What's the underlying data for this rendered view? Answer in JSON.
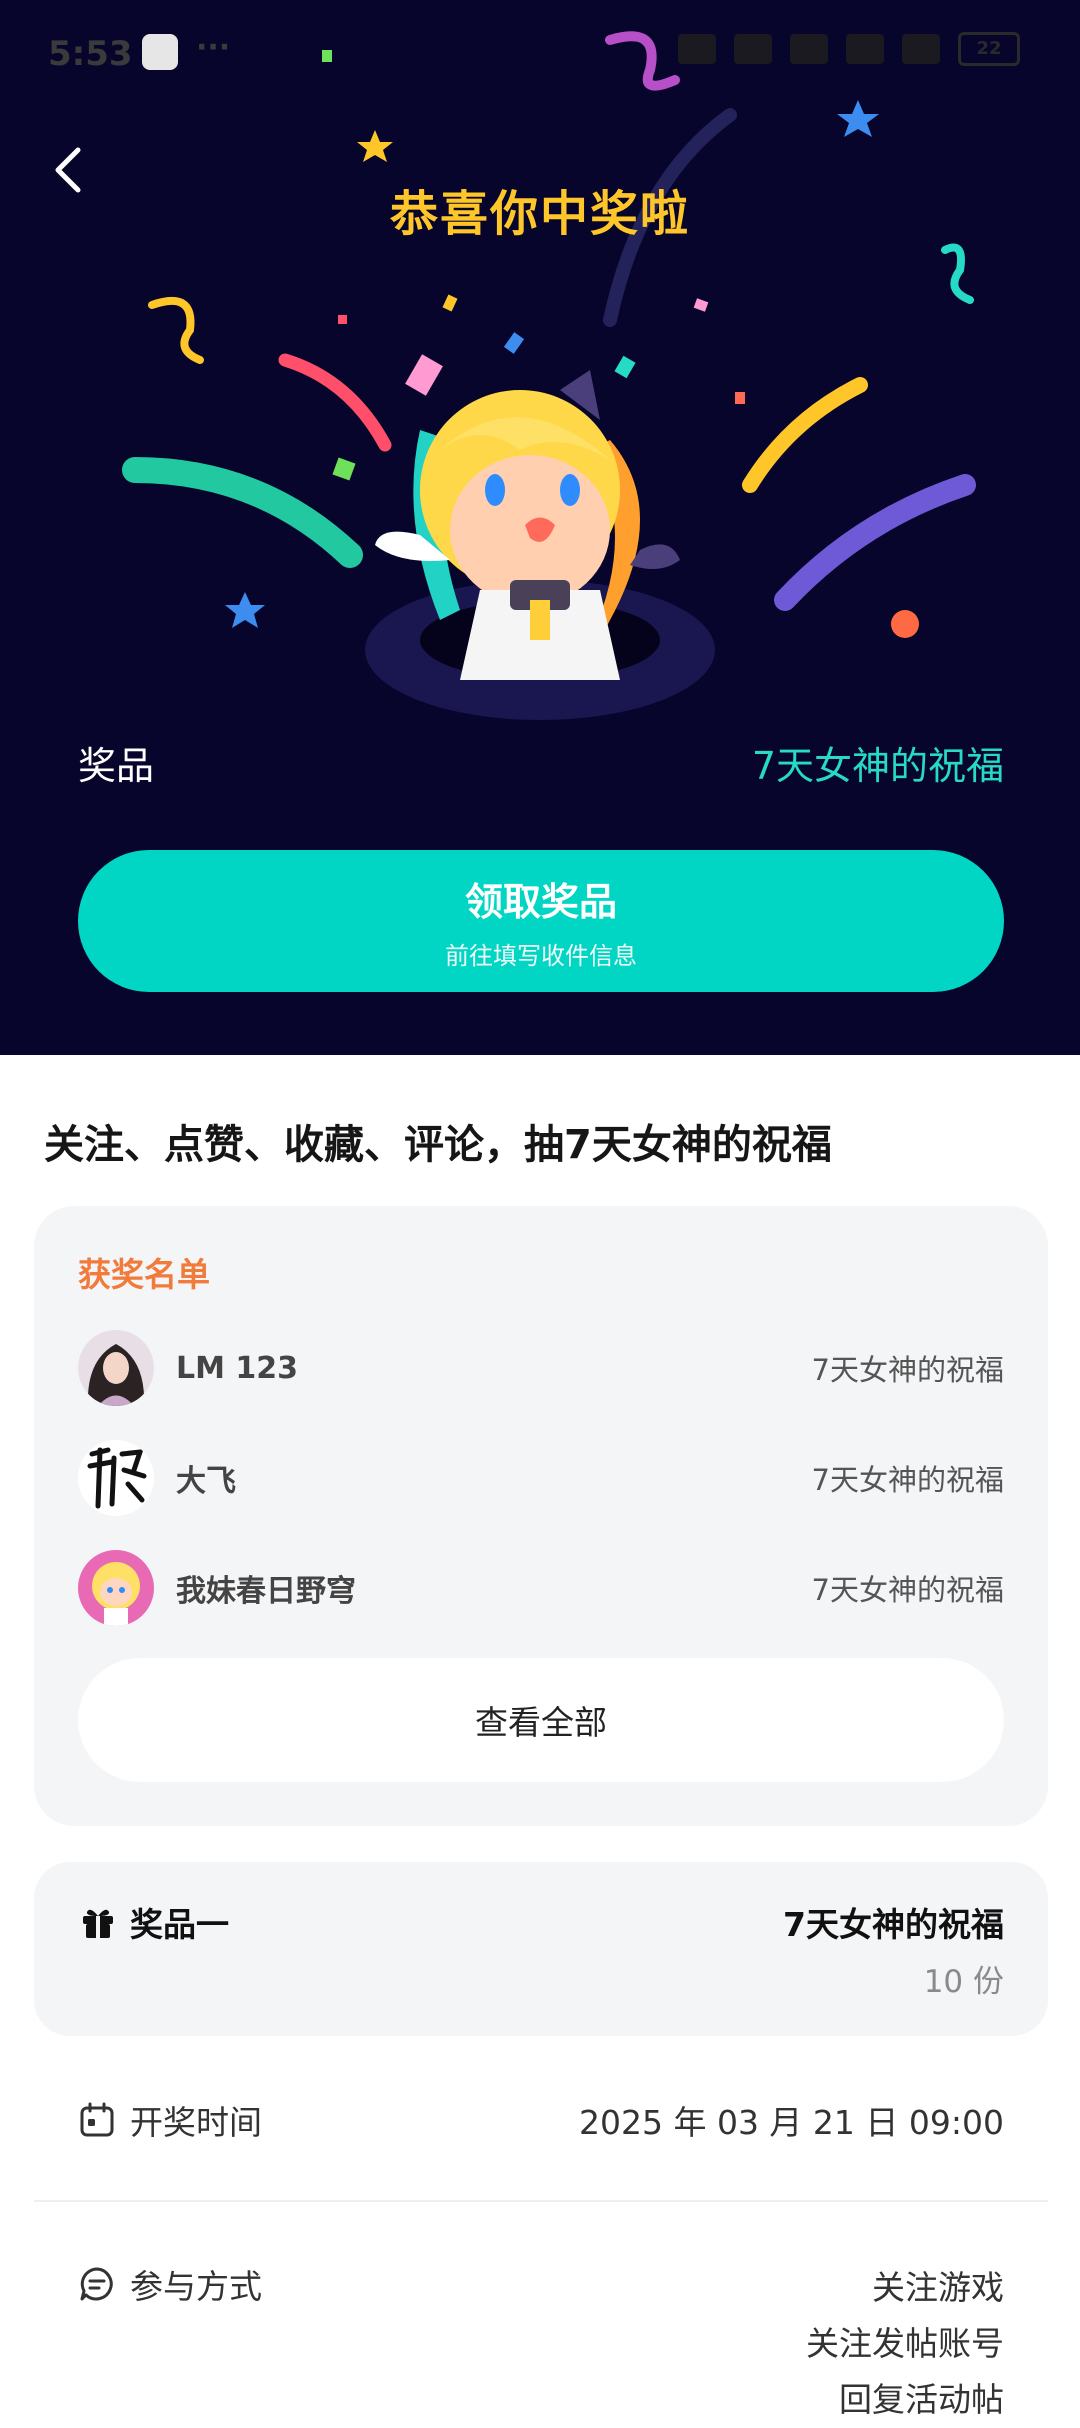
{
  "status_bar": {
    "time": "5:53",
    "more": "···",
    "battery": "22"
  },
  "hero": {
    "title": "恭喜你中奖啦",
    "prize_label": "奖品",
    "prize_value": "7天女神的祝福",
    "claim_button": {
      "title": "领取奖品",
      "subtitle": "前往填写收件信息"
    }
  },
  "activity": {
    "title": "关注、点赞、收藏、评论，抽7天女神的祝福"
  },
  "winners": {
    "heading": "获奖名单",
    "items": [
      {
        "name": "LM 123",
        "prize": "7天女神的祝福"
      },
      {
        "name": "大飞",
        "prize": "7天女神的祝福"
      },
      {
        "name": "我妹春日野穹",
        "prize": "7天女神的祝福"
      }
    ],
    "view_all": "查看全部"
  },
  "prize_card": {
    "label": "奖品一",
    "name": "7天女神的祝福",
    "quantity": "10 份"
  },
  "draw_time": {
    "label": "开奖时间",
    "value": "2025 年 03 月 21 日 09:00"
  },
  "participation": {
    "label": "参与方式",
    "methods": [
      "关注游戏",
      "关注发帖账号",
      "回复活动帖"
    ]
  },
  "colors": {
    "hero_bg": "#07052b",
    "title_gold": "#ffc629",
    "accent_teal": "#00d6c3",
    "winners_heading": "#f27a3a"
  }
}
